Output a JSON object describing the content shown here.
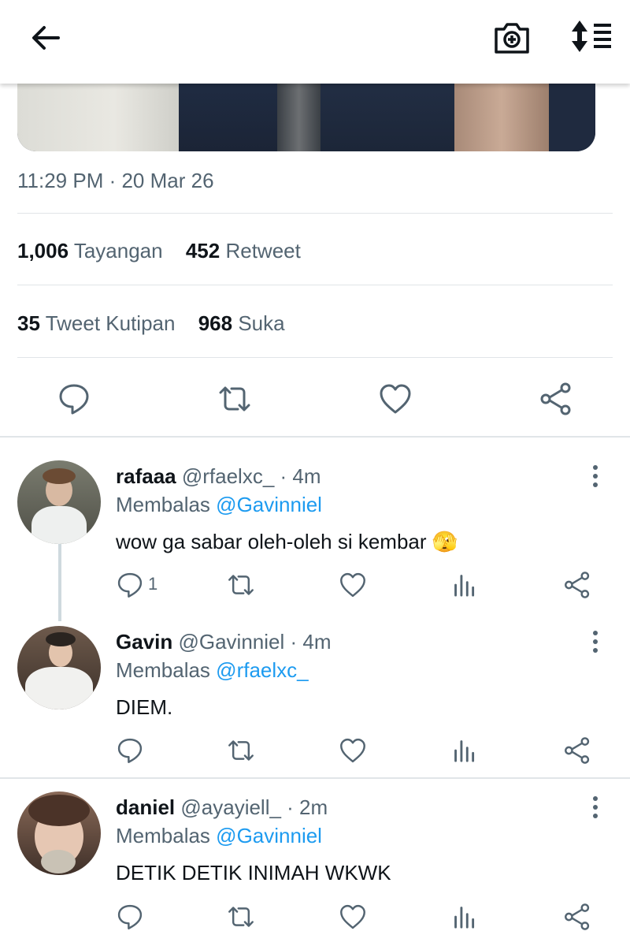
{
  "topbar": {
    "back_icon": "arrow-left-icon",
    "camera_icon": "camera-plus-icon",
    "sort_icon": "sort-icon"
  },
  "tweet": {
    "timestamp": "11:29 PM · 20 Mar 26",
    "views_count": "1,006",
    "views_label": "Tayangan",
    "retweets_count": "452",
    "retweets_label": "Retweet",
    "quotes_count": "35",
    "quotes_label": "Tweet Kutipan",
    "likes_count": "968",
    "likes_label": "Suka",
    "action_icons": [
      "reply-icon",
      "retweet-icon",
      "like-icon",
      "share-icon"
    ]
  },
  "replies": [
    {
      "name": "rafaaa",
      "handle": "@rfaelxc_",
      "time": "· 4m",
      "replying_label": "Membalas",
      "replying_to": "@Gavinniel",
      "text": "wow ga sabar oleh-oleh si kembar 🫣",
      "reply_count": "1"
    },
    {
      "name": "Gavin",
      "handle": "@Gavinniel",
      "time": "· 4m",
      "replying_label": "Membalas",
      "replying_to": "@rfaelxc_",
      "text": "DIEM.",
      "reply_count": ""
    },
    {
      "name": "daniel",
      "handle": "@ayayiell_",
      "time": "· 2m",
      "replying_label": "Membalas",
      "replying_to": "@Gavinniel",
      "text": "DETIK DETIK INIMAH WKWK",
      "reply_count": ""
    }
  ],
  "colors": {
    "accent": "#1d9bf0",
    "secondary_text": "#536471",
    "primary_text": "#0f1419"
  }
}
